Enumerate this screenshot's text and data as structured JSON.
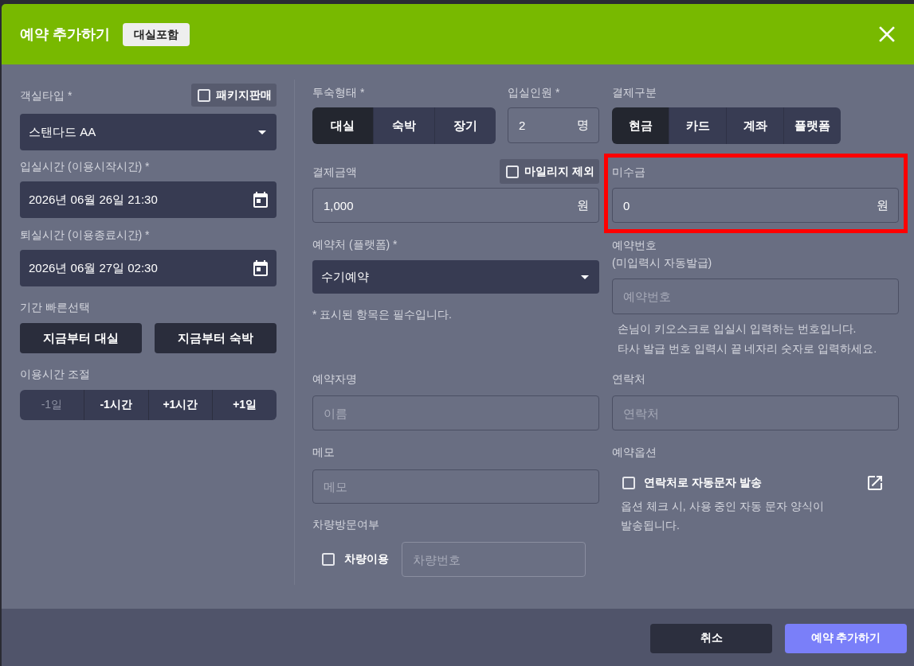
{
  "header": {
    "title": "예약 추가하기",
    "badge": "대실포함"
  },
  "room_type": {
    "label": "객실타입 *",
    "package_option": {
      "label": "패키지판매",
      "checked": false
    },
    "value": "스탠다드 AA"
  },
  "check_in": {
    "label": "입실시간 (이용시작시간) *",
    "value": "2026년 06월 26일 21:30"
  },
  "check_out": {
    "label": "퇴실시간 (이용종료시간) *",
    "value": "2026년 06월 27일 02:30"
  },
  "quick_select": {
    "label": "기간 빠른선택",
    "buttons": [
      "지금부터 대실",
      "지금부터 숙박"
    ]
  },
  "time_adjust": {
    "label": "이용시간 조절",
    "buttons": [
      {
        "label": "-1일",
        "disabled": true
      },
      {
        "label": "-1시간",
        "disabled": false
      },
      {
        "label": "+1시간",
        "disabled": false
      },
      {
        "label": "+1일",
        "disabled": false
      }
    ]
  },
  "stay_type": {
    "label": "투숙형태 *",
    "options": [
      {
        "label": "대실",
        "selected": true
      },
      {
        "label": "숙박",
        "selected": false
      },
      {
        "label": "장기",
        "selected": false
      }
    ]
  },
  "guests": {
    "label": "입실인원 *",
    "value": "2",
    "unit": "명"
  },
  "payment_method": {
    "label": "결제구분",
    "options": [
      {
        "label": "현금",
        "selected": true
      },
      {
        "label": "카드",
        "selected": false
      },
      {
        "label": "계좌",
        "selected": false
      },
      {
        "label": "플랫폼",
        "selected": false
      }
    ]
  },
  "amount": {
    "label": "결제금액",
    "mileage_option": {
      "label": "마일리지 제외",
      "checked": false
    },
    "value": "1,000",
    "unit": "원"
  },
  "unpaid": {
    "label": "미수금",
    "value": "0",
    "unit": "원",
    "highlighted": true
  },
  "platform": {
    "label": "예약처 (플랫폼) *",
    "value": "수기예약"
  },
  "required_note": "* 표시된 항목은 필수입니다.",
  "reservation_number": {
    "label": "예약번호",
    "sublabel": "(미입력시 자동발급)",
    "placeholder": "예약번호",
    "help": [
      "손님이 키오스크로 입실시 입력하는 번호입니다.",
      "타사 발급 번호 입력시 끝 네자리 숫자로 입력하세요."
    ]
  },
  "guest_name": {
    "label": "예약자명",
    "placeholder": "이름"
  },
  "contact": {
    "label": "연락처",
    "placeholder": "연락처"
  },
  "memo": {
    "label": "메모",
    "placeholder": "메모"
  },
  "reservation_options": {
    "label": "예약옵션",
    "auto_sms": {
      "label": "연락처로 자동문자 발송",
      "checked": false
    },
    "note": "옵션 체크 시, 사용 중인 자동 문자 양식이 발송됩니다."
  },
  "vehicle": {
    "label": "차량방문여부",
    "use_vehicle": {
      "label": "차량이용",
      "checked": false
    },
    "placeholder": "차량번호"
  },
  "footer": {
    "buttons": [
      {
        "label": "취소",
        "kind": "secondary"
      },
      {
        "label": "예약 추가하기",
        "kind": "primary"
      }
    ]
  }
}
